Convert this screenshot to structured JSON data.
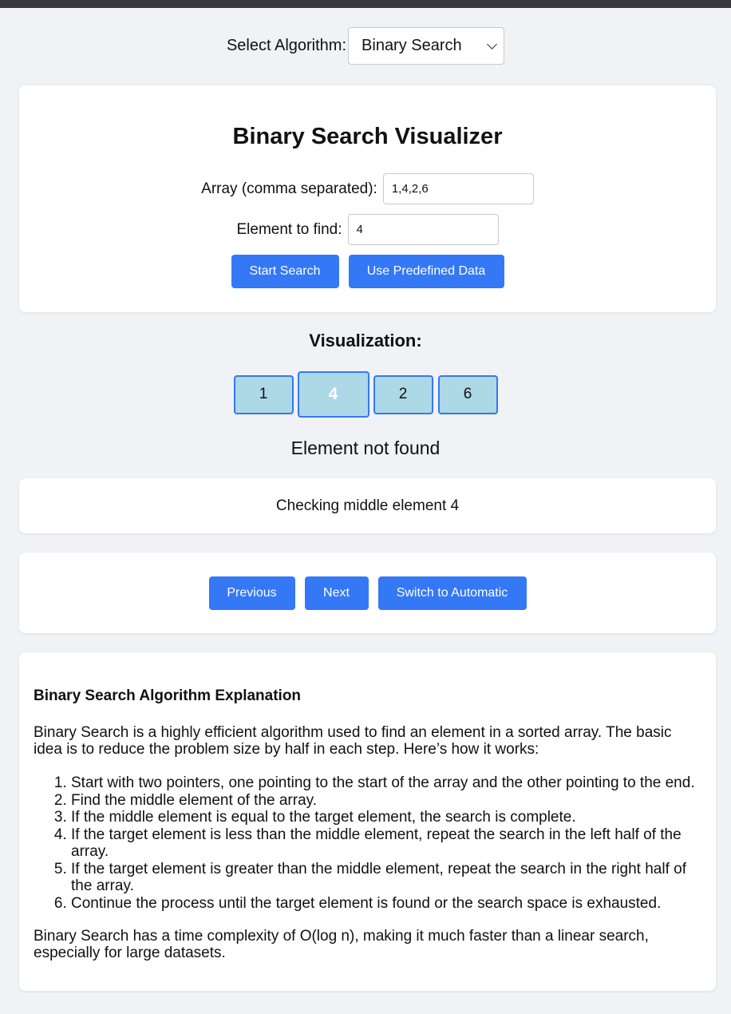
{
  "selector": {
    "label": "Select Algorithm:",
    "selected": "Binary Search"
  },
  "input_card": {
    "title": "Binary Search Visualizer",
    "array_label": "Array (comma separated):",
    "array_value": "1,4,2,6",
    "target_label": "Element to find:",
    "target_value": "4",
    "start_button": "Start Search",
    "predefined_button": "Use Predefined Data"
  },
  "visualization": {
    "heading": "Visualization:",
    "cells": [
      "1",
      "4",
      "2",
      "6"
    ],
    "active_index": 1,
    "result": "Element not found"
  },
  "step": {
    "message": "Checking middle element 4"
  },
  "controls": {
    "previous": "Previous",
    "next": "Next",
    "mode_toggle": "Switch to Automatic"
  },
  "explanation": {
    "heading": "Binary Search Algorithm Explanation",
    "intro": "Binary Search is a highly efficient algorithm used to find an element in a sorted array. The basic idea is to reduce the problem size by half in each step. Here’s how it works:",
    "steps": [
      "Start with two pointers, one pointing to the start of the array and the other pointing to the end.",
      "Find the middle element of the array.",
      "If the middle element is equal to the target element, the search is complete.",
      "If the target element is less than the middle element, repeat the search in the left half of the array.",
      "If the target element is greater than the middle element, repeat the search in the right half of the array.",
      "Continue the process until the target element is found or the search space is exhausted."
    ],
    "outro": "Binary Search has a time complexity of O(log n), making it much faster than a linear search, especially for large datasets."
  },
  "colors": {
    "accent": "#3478f6",
    "cell_fill": "#add8e6",
    "page_background": "#f0f2f5"
  }
}
